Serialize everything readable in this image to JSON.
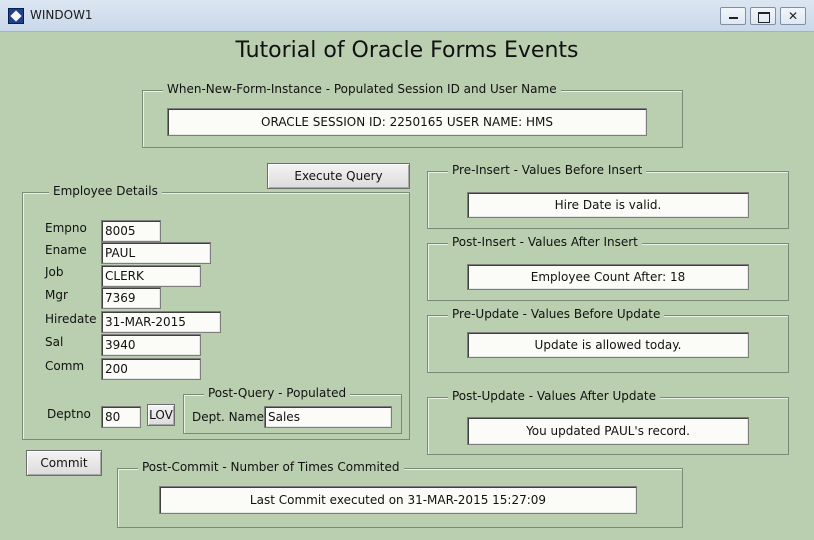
{
  "window": {
    "title": "WINDOW1"
  },
  "form": {
    "title": "Tutorial of Oracle Forms Events"
  },
  "when_new_form_instance": {
    "title": "When-New-Form-Instance - Populated Session ID and User Name",
    "value": "ORACLE SESSION ID: 2250165 USER NAME: HMS"
  },
  "buttons": {
    "execute_query": "Execute Query",
    "lov": "LOV",
    "commit": "Commit"
  },
  "employee": {
    "title": "Employee Details",
    "labels": {
      "empno": "Empno",
      "ename": "Ename",
      "job": "Job",
      "mgr": "Mgr",
      "hiredate": "Hiredate",
      "sal": "Sal",
      "comm": "Comm",
      "deptno": "Deptno"
    },
    "values": {
      "empno": "8005",
      "ename": "PAUL",
      "job": "CLERK",
      "mgr": "7369",
      "hiredate": "31-MAR-2015",
      "sal": "3940",
      "comm": "200",
      "deptno": "80"
    }
  },
  "post_query": {
    "title": "Post-Query - Populated",
    "label": "Dept. Name",
    "value": "Sales"
  },
  "pre_insert": {
    "title": "Pre-Insert - Values Before Insert",
    "value": "Hire Date is valid."
  },
  "post_insert": {
    "title": "Post-Insert - Values After Insert",
    "value": "Employee Count After: 18"
  },
  "pre_update": {
    "title": "Pre-Update - Values Before Update",
    "value": "Update is allowed today."
  },
  "post_update": {
    "title": "Post-Update - Values After Update",
    "value": "You updated PAUL's record."
  },
  "post_commit": {
    "title": "Post-Commit - Number of Times Commited",
    "value": "Last Commit executed on 31-MAR-2015 15:27:09"
  }
}
